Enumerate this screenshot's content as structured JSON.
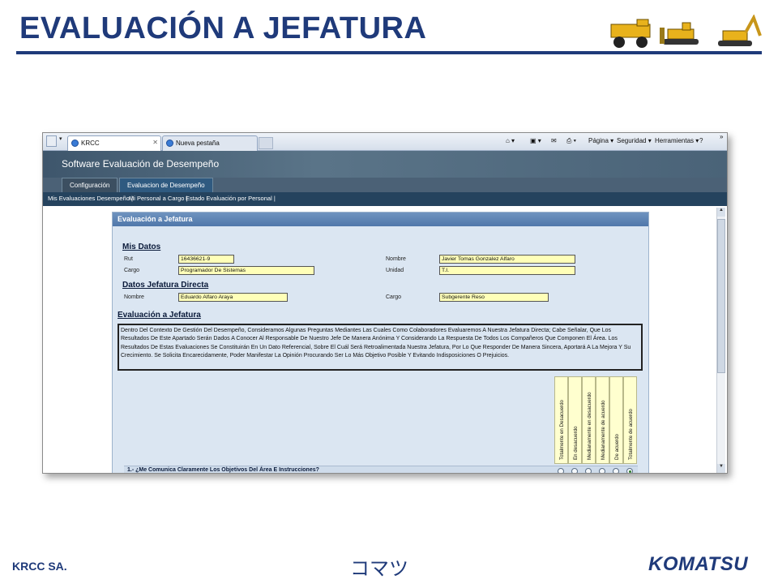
{
  "slide": {
    "title": "EVALUACIÓN A JEFATURA",
    "footer_left": "KRCC SA.",
    "footer_middle": "コマツ",
    "footer_right": "KOMATSU",
    "accent_color": "#1f3a7a"
  },
  "browser": {
    "tabs": [
      {
        "label": "KRCC",
        "active": true
      },
      {
        "label": "Nueva pestaña",
        "active": false
      }
    ],
    "commands": {
      "page": "Página ▾",
      "security": "Seguridad ▾",
      "tools": "Herramientas ▾",
      "help": "?",
      "more": "»"
    }
  },
  "app": {
    "title": "Software Evaluación de Desempeño",
    "tabs": [
      "Configuración",
      "Evaluacion de Desempeño"
    ],
    "subnav": [
      "Mis Evaluaciones Desempeño |",
      "Mi Personal a Cargo |",
      "Estado Evaluación por Personal |"
    ]
  },
  "panel": {
    "header": "Evaluación a Jefatura",
    "mis_datos": {
      "heading": "Mis Datos",
      "rut_label": "Rut",
      "rut_value": "16436621-9",
      "nombre_label": "Nombre",
      "nombre_value": "Javier Tomas Gonzalez Alfaro",
      "cargo_label": "Cargo",
      "cargo_value": "Programador De Sistemas",
      "unidad_label": "Unidad",
      "unidad_value": "T.I."
    },
    "jefatura": {
      "heading": "Datos Jefatura Directa",
      "nombre_label": "Nombre",
      "nombre_value": "Eduardo Alfaro Araya",
      "cargo_label": "Cargo",
      "cargo_value": "Subgerente Reso"
    },
    "evaluacion": {
      "heading": "Evaluación a Jefatura",
      "intro": "Dentro Del Contexto De Gestión Del Desempeño, Consideramos Algunas Preguntas Mediantes Las Cuales Como Colaboradores Evaluaremos A Nuestra Jefatura Directa; Cabe Señalar, Que Los Resultados De Este Apartado Serán Dados A Conocer Al Responsable De Nuestro Jefe De Manera Anónima Y Considerando La Respuesta De Todos Los Compañeros Que Componen El Área. Los Resultados De Estas Evaluaciones Se Constituirán En Un Dato Referencial, Sobre El Cuál Será Retroalimentada Nuestra Jefatura, Por Lo Que Responder De Manera Sincera, Aportará A La Mejora Y Su Crecimiento. Se Solicita Encarecidamente, Poder Manifestar La Opinión Procurando Ser Lo Más Objetivo Posible Y Evitando Indisposiciones O Prejuicios.",
      "scale": [
        "Totalmente en Desacuerdo",
        "En desacuerdo",
        "Medianamente en desacuerdo",
        "Medianamente de acuerdo",
        "De acuerdo",
        "Totalmente de acuerdo"
      ],
      "question_1": "1.- ¿Me Comunica Claramente Los Objetivos Del Área E Instrucciones?",
      "question_1_selected_index": 5
    }
  }
}
